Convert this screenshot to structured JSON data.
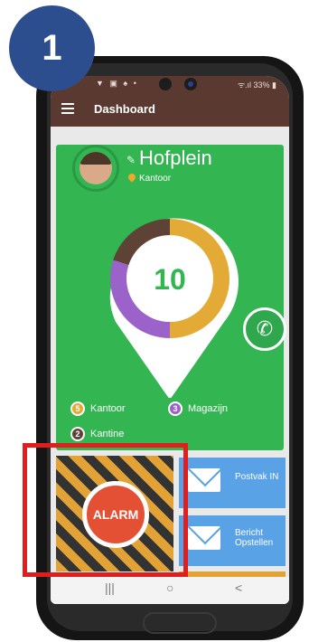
{
  "step_badge": "1",
  "status_bar": {
    "left_icons": "▼ ▣ ♠ •",
    "right": "ᯤ.ıl 33% ▮"
  },
  "app_bar": {
    "title": "Dashboard",
    "menu_icon": "hamburger-icon"
  },
  "location": {
    "name": "Hofplein",
    "type": "Kantoor"
  },
  "chart_data": {
    "type": "pie",
    "center_value": "10",
    "segments": [
      {
        "name": "Kantoor",
        "value": 5,
        "color": "#e3aa36"
      },
      {
        "name": "Magazijn",
        "value": 3,
        "color": "#9b63c9"
      },
      {
        "name": "Kantine",
        "value": 2,
        "color": "#5d4235"
      }
    ]
  },
  "legend": [
    {
      "count": "5",
      "label": "Kantoor",
      "color": "#e3aa36"
    },
    {
      "count": "3",
      "label": "Magazijn",
      "color": "#9b63c9"
    },
    {
      "count": "2",
      "label": "Kantine",
      "color": "#5d4235"
    }
  ],
  "tiles": {
    "alarm": "ALARM",
    "inbox": "Postvak IN",
    "compose_line1": "Bericht",
    "compose_line2": "Opstellen"
  },
  "nav": {
    "recents": "|||",
    "home": "○",
    "back": "<"
  },
  "colors": {
    "brand": "#5a3a30",
    "card": "#33b551",
    "alarm": "#e45034",
    "tile_blue": "#5aa2e6",
    "highlight": "#e11d1d",
    "badge": "#2c4e8f"
  }
}
